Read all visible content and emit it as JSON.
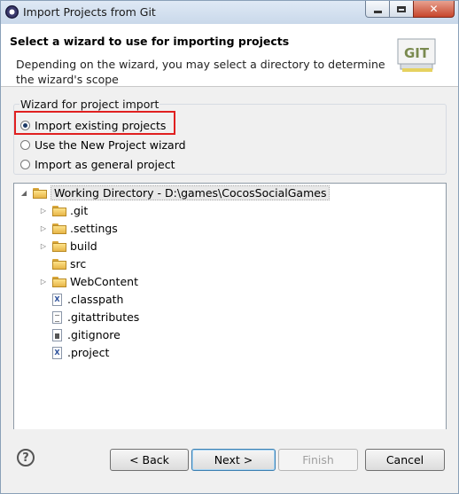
{
  "window": {
    "title": "Import Projects from Git"
  },
  "header": {
    "title": "Select a wizard to use for importing projects",
    "description": "Depending on the wizard, you may select a directory to determine the wizard's scope",
    "logo_text": "GIT"
  },
  "wizard_group": {
    "legend": "Wizard for project import",
    "options": [
      {
        "label": "Import existing projects",
        "selected": true
      },
      {
        "label": "Use the New Project wizard",
        "selected": false
      },
      {
        "label": "Import as general project",
        "selected": false
      }
    ]
  },
  "tree": {
    "root": "Working Directory - D:\\games\\CocosSocialGames",
    "items": [
      {
        "label": ".git",
        "type": "folder",
        "expandable": true
      },
      {
        "label": ".settings",
        "type": "folder",
        "expandable": true
      },
      {
        "label": "build",
        "type": "folder",
        "expandable": true
      },
      {
        "label": "src",
        "type": "folder",
        "expandable": false
      },
      {
        "label": "WebContent",
        "type": "folder",
        "expandable": true
      },
      {
        "label": ".classpath",
        "type": "xml-file",
        "expandable": false
      },
      {
        "label": ".gitattributes",
        "type": "text-file",
        "expandable": false
      },
      {
        "label": ".gitignore",
        "type": "file",
        "expandable": false
      },
      {
        "label": ".project",
        "type": "xml-file",
        "expandable": false
      }
    ]
  },
  "buttons": {
    "help": "?",
    "back": "< Back",
    "next": "Next >",
    "finish": "Finish",
    "cancel": "Cancel"
  },
  "colors": {
    "highlight": "#e02020",
    "titlebar": "#c9d8ea"
  }
}
